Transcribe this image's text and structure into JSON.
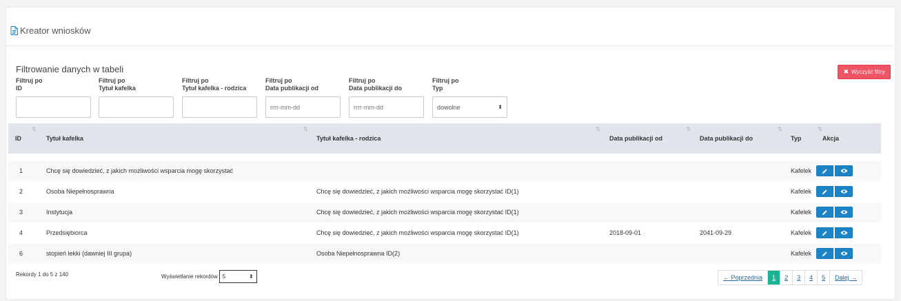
{
  "header": {
    "title": "Kreator wniosków",
    "icon": "document-icon"
  },
  "section_title": "Filtrowanie danych w tabeli",
  "clear_button": {
    "icon": "x",
    "label": "Wyczyść filtry",
    "color": "#ed5565"
  },
  "filters": [
    {
      "label1": "Filtruj po",
      "label2": "ID",
      "value": "",
      "placeholder": ""
    },
    {
      "label1": "Filtruj po",
      "label2": "Tytuł kafelka",
      "value": "",
      "placeholder": ""
    },
    {
      "label1": "Filtruj po",
      "label2": "Tytuł kafelka - rodzica",
      "value": "",
      "placeholder": ""
    },
    {
      "label1": "Filtruj po",
      "label2": "Data publikacji od",
      "value": "",
      "placeholder": "rrrr-mm-dd"
    },
    {
      "label1": "Filtruj po",
      "label2": "Data publikacji do",
      "value": "",
      "placeholder": "rrrr-mm-dd"
    },
    {
      "label1": "Filtruj po",
      "label2": "Typ",
      "value": "dowolne",
      "placeholder": ""
    }
  ],
  "columns": [
    "ID",
    "Tytuł kafelka",
    "Tytuł kafelka - rodzica",
    "Data publikacji od",
    "Data publikacji do",
    "Typ",
    "Akcja"
  ],
  "rows": [
    {
      "id": "1",
      "title": "Chcę się dowiedzieć, z jakich możliwości wsparcia mogę skorzystać",
      "parent": "",
      "from": "",
      "to": "",
      "type": "Kafelek"
    },
    {
      "id": "2",
      "title": "Osoba Niepełnosprawna",
      "parent": "Chcę się dowiedzieć, z jakich możliwości wsparcia mogę skorzystać ID(1)",
      "from": "",
      "to": "",
      "type": "Kafelek"
    },
    {
      "id": "3",
      "title": "Instytucja",
      "parent": "Chcę się dowiedzieć, z jakich możliwości wsparcia mogę skorzystać ID(1)",
      "from": "",
      "to": "",
      "type": "Kafelek"
    },
    {
      "id": "4",
      "title": "Przedsiębiorca",
      "parent": "Chcę się dowiedzieć, z jakich możliwości wsparcia mogę skorzystać ID(1)",
      "from": "2018-09-01",
      "to": "2041-09-29",
      "type": "Kafelek"
    },
    {
      "id": "6",
      "title": "stopień lekki (dawniej III grupa)",
      "parent": "Osoba Niepełnosprawna ID(2)",
      "from": "",
      "to": "",
      "type": "Kafelek"
    }
  ],
  "footer": {
    "records_info": "Rekordy 1 do 5 z 140",
    "page_length_label": "Wyświetlanie rekordów",
    "page_length_value": "5"
  },
  "pagination": {
    "prev": "← Poprzednia",
    "pages": [
      "1",
      "2",
      "3",
      "4",
      "5"
    ],
    "active": "1",
    "next": "Dalej →",
    "active_color": "#1ab394"
  },
  "colors": {
    "action_button": "#1c84c6",
    "table_header": "#e1e5eb"
  }
}
